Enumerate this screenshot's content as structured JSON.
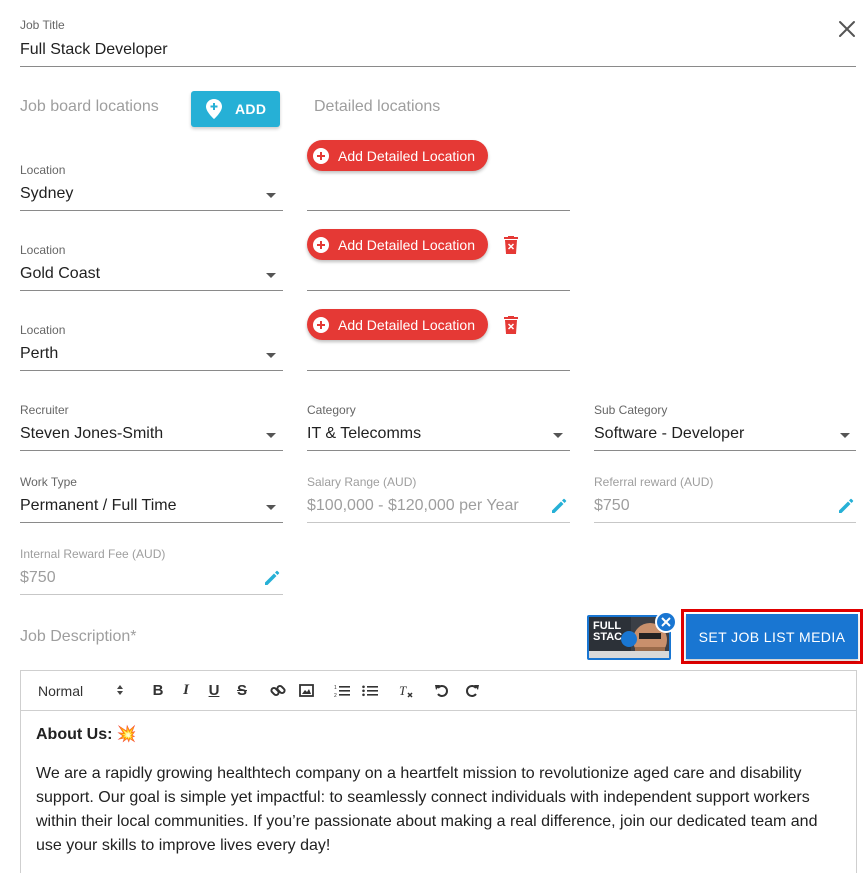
{
  "job_title": {
    "label": "Job Title",
    "value": "Full Stack Developer"
  },
  "locations_header": {
    "job_board_label": "Job board locations",
    "add_label": "ADD",
    "detailed_label": "Detailed locations"
  },
  "locations": [
    {
      "label": "Location",
      "value": "Sydney",
      "detail_button": "Add Detailed Location",
      "deletable": false
    },
    {
      "label": "Location",
      "value": "Gold Coast",
      "detail_button": "Add Detailed Location",
      "deletable": true
    },
    {
      "label": "Location",
      "value": "Perth",
      "detail_button": "Add Detailed Location",
      "deletable": true
    }
  ],
  "recruiter": {
    "label": "Recruiter",
    "value": "Steven Jones-Smith"
  },
  "category": {
    "label": "Category",
    "value": "IT & Telecomms"
  },
  "sub_category": {
    "label": "Sub Category",
    "value": "Software - Developer"
  },
  "work_type": {
    "label": "Work Type",
    "value": "Permanent / Full Time"
  },
  "salary_range": {
    "label": "Salary Range (AUD)",
    "value": "$100,000 - $120,000 per Year"
  },
  "referral_reward": {
    "label": "Referral reward (AUD)",
    "value": "$750"
  },
  "internal_reward": {
    "label": "Internal Reward Fee (AUD)",
    "value": "$750"
  },
  "description": {
    "label": "Job Description*",
    "media_thumb_text": "FULL STAC",
    "media_button": "SET JOB LIST MEDIA"
  },
  "editor": {
    "toolbar": {
      "format": "Normal"
    },
    "heading": "About Us: 💥",
    "paragraph": "We are a rapidly growing healthtech company on a heartfelt mission to revolutionize aged care and disability support. Our goal is simple yet impactful: to seamlessly connect individuals with independent support workers within their local communities. If you’re passionate about making a real difference, join our dedicated team and use your skills to improve lives every day!"
  },
  "colors": {
    "accent_cyan": "#26b0d6",
    "danger_red": "#e53935",
    "primary_blue": "#1976d2",
    "highlight_red": "#e00000"
  }
}
